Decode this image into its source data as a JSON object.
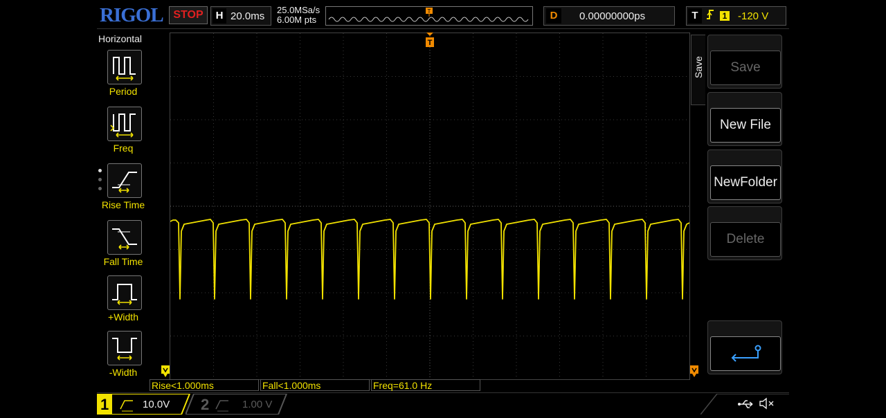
{
  "header": {
    "brand": "RIGOL",
    "run_state": "STOP",
    "timebase_key": "H",
    "timebase_value": "20.0ms",
    "sample_rate": "25.0MSa/s",
    "memory_depth": "6.00M pts",
    "delay_key": "D",
    "delay_value": "0.00000000ps",
    "trigger_key": "T",
    "trigger_source": "1",
    "trigger_level": "-120 V"
  },
  "left_menu": {
    "title": "Horizontal",
    "items": [
      {
        "label": "Period",
        "icon": "period-icon"
      },
      {
        "label": "Freq",
        "icon": "frequency-icon"
      },
      {
        "label": "Rise Time",
        "icon": "rise-time-icon"
      },
      {
        "label": "Fall Time",
        "icon": "fall-time-icon"
      },
      {
        "label": "+Width",
        "icon": "positive-width-icon"
      },
      {
        "label": "-Width",
        "icon": "negative-width-icon"
      }
    ]
  },
  "right_menu": {
    "tab_label": "Save",
    "buttons": [
      {
        "label": "Save",
        "enabled": false
      },
      {
        "label": "New File",
        "enabled": true
      },
      {
        "label": "NewFolder",
        "enabled": true
      },
      {
        "label": "Delete",
        "enabled": false
      }
    ],
    "enter_icon": "enter-arrow-icon"
  },
  "measurements": [
    {
      "text": "Rise<1.000ms"
    },
    {
      "text": "Fall<1.000ms"
    },
    {
      "text": "Freq=61.0 Hz"
    }
  ],
  "channels": [
    {
      "number": "1",
      "scale": "10.0V",
      "active": true,
      "color": "#f2e200"
    },
    {
      "number": "2",
      "scale": "1.00 V",
      "active": false,
      "color": "#5a5a5a"
    }
  ],
  "status_icons": [
    "usb-icon",
    "mute-icon"
  ],
  "colors": {
    "channel1": "#f2e200",
    "trigger_marker": "#f08a00",
    "stop": "#e02020",
    "brand": "#3a6fd4"
  }
}
